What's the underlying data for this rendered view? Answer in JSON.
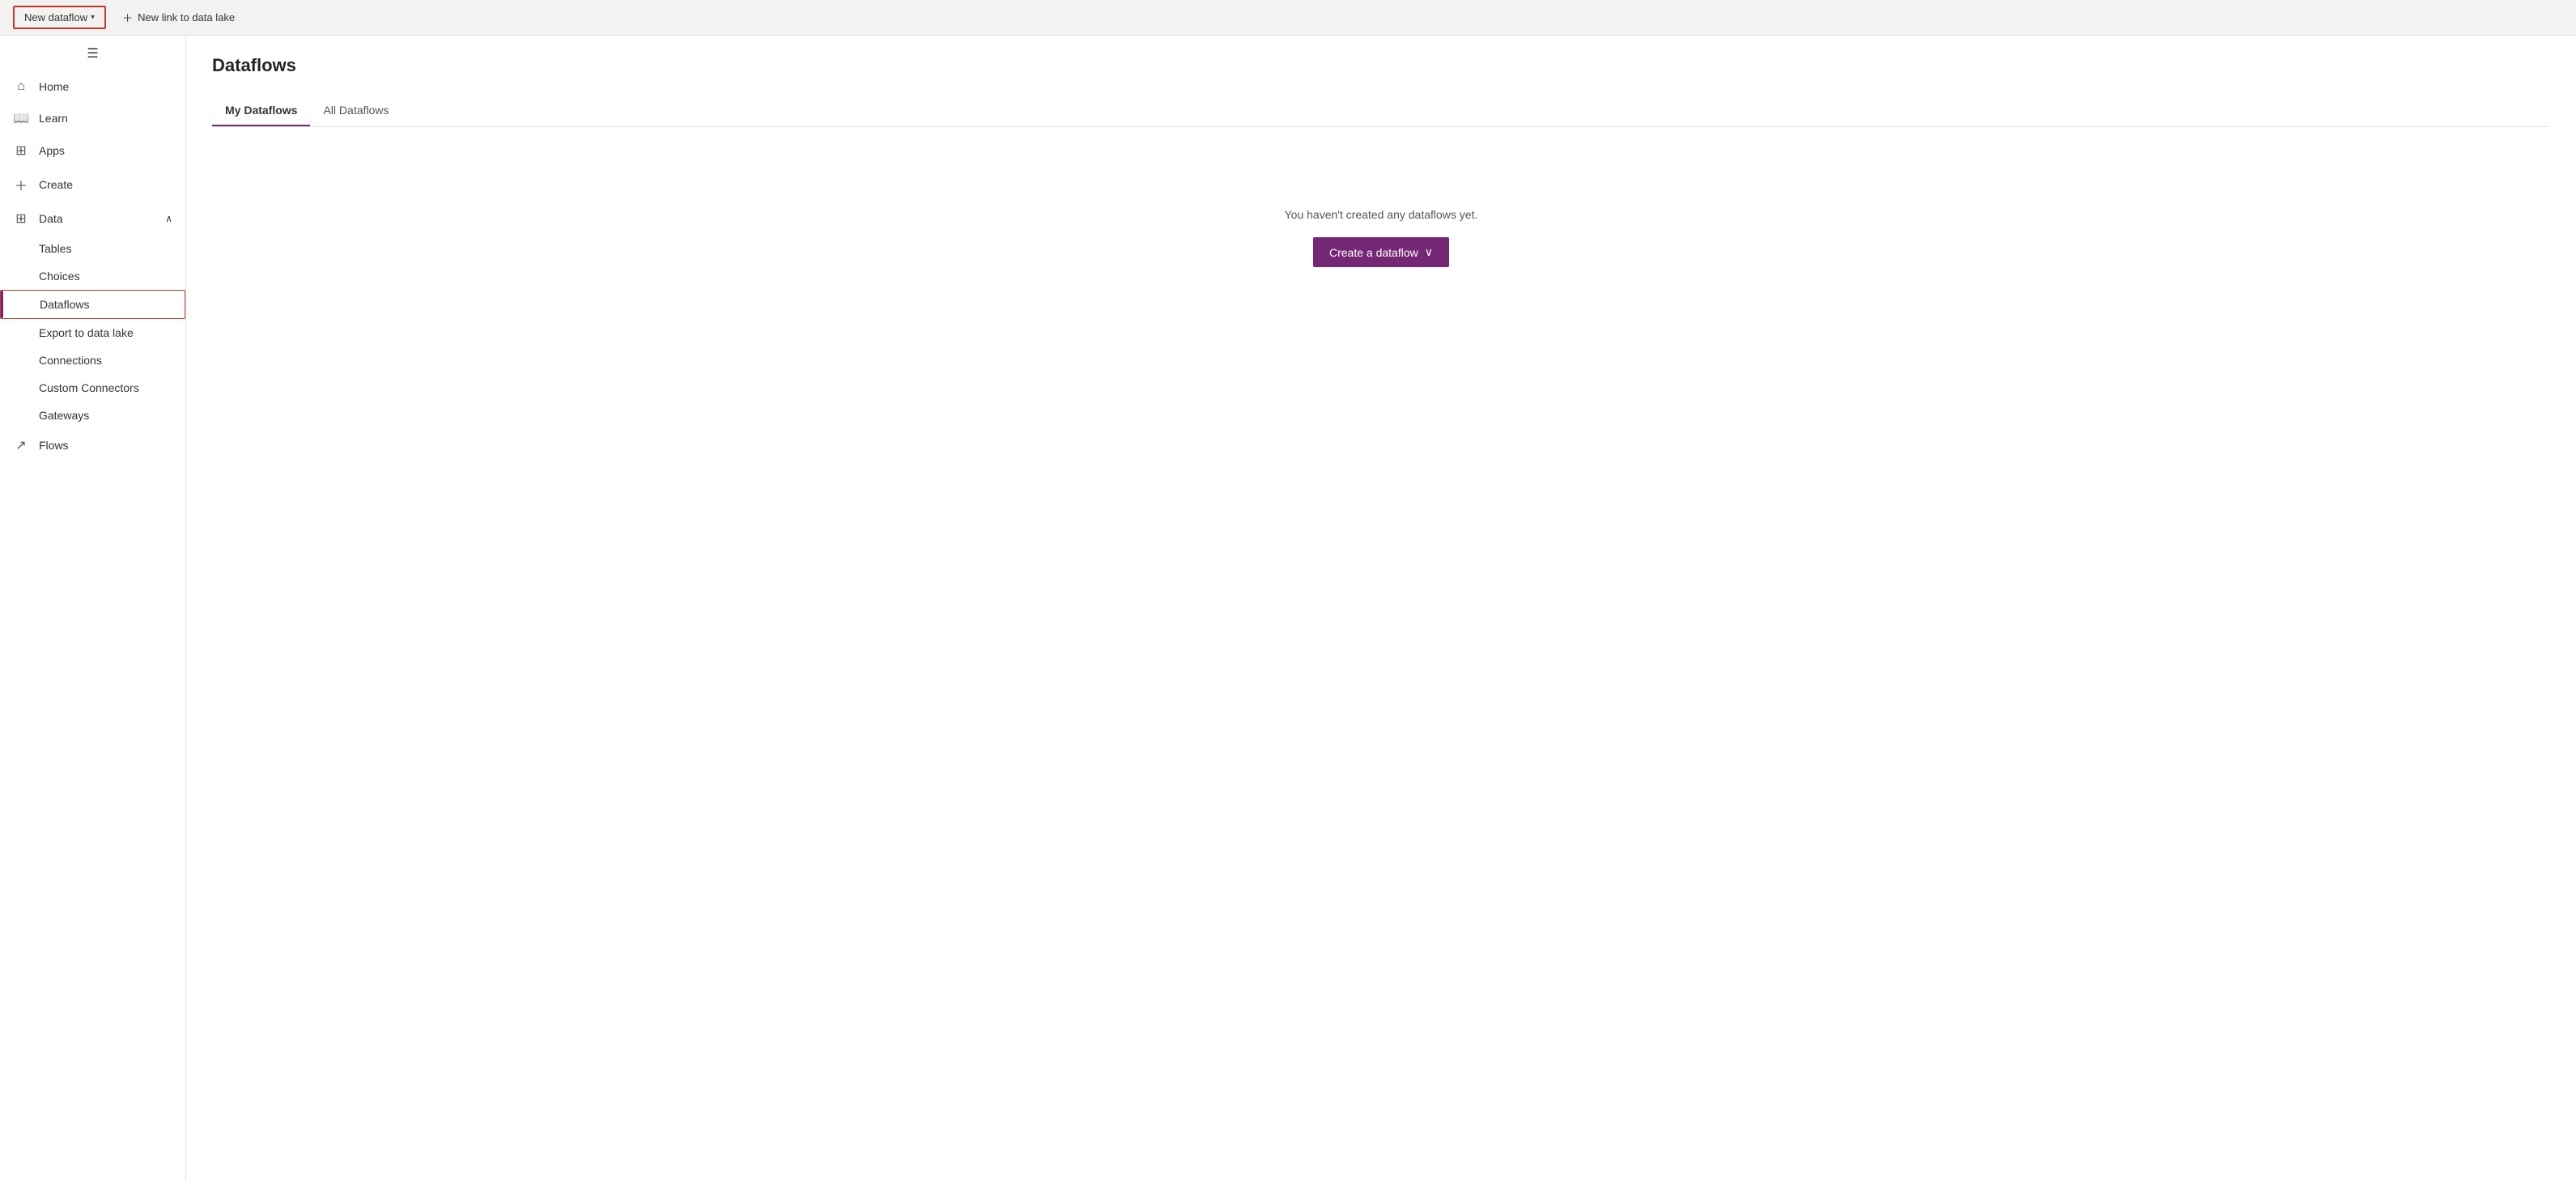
{
  "topbar": {
    "new_dataflow_label": "New dataflow",
    "new_link_label": "New link to data lake"
  },
  "sidebar": {
    "hamburger_icon": "☰",
    "items": [
      {
        "id": "home",
        "label": "Home",
        "icon": "⌂"
      },
      {
        "id": "learn",
        "label": "Learn",
        "icon": "📖"
      },
      {
        "id": "apps",
        "label": "Apps",
        "icon": "+"
      },
      {
        "id": "create",
        "label": "Create",
        "icon": "+"
      },
      {
        "id": "data",
        "label": "Data",
        "icon": "⊞",
        "expandable": true,
        "expanded": true
      }
    ],
    "data_subitems": [
      {
        "id": "tables",
        "label": "Tables"
      },
      {
        "id": "choices",
        "label": "Choices"
      },
      {
        "id": "dataflows",
        "label": "Dataflows",
        "active": true
      },
      {
        "id": "export-to-data-lake",
        "label": "Export to data lake"
      },
      {
        "id": "connections",
        "label": "Connections"
      },
      {
        "id": "custom-connectors",
        "label": "Custom Connectors"
      },
      {
        "id": "gateways",
        "label": "Gateways"
      }
    ],
    "flows_item": {
      "id": "flows",
      "label": "Flows",
      "icon": "↗"
    }
  },
  "content": {
    "page_title": "Dataflows",
    "tabs": [
      {
        "id": "my-dataflows",
        "label": "My Dataflows",
        "active": true
      },
      {
        "id": "all-dataflows",
        "label": "All Dataflows",
        "active": false
      }
    ],
    "empty_message": "You haven't created any dataflows yet.",
    "create_button_label": "Create a dataflow"
  }
}
